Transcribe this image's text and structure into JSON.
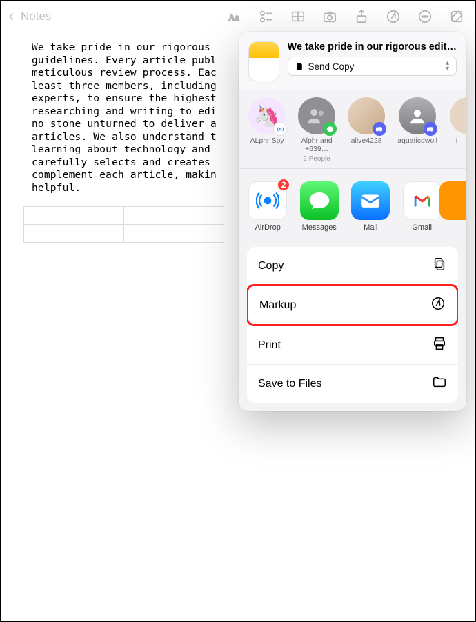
{
  "toolbar": {
    "back_label": "Notes",
    "icons": [
      "text-format",
      "checklist",
      "table",
      "camera",
      "share",
      "markup",
      "more",
      "compose"
    ]
  },
  "note": {
    "body": "We take pride in our rigorous\nguidelines. Every article publ\nmeticulous review process. Eac\nleast three members, including\nexperts, to ensure the highest\nresearching and writing to edi\nno stone unturned to deliver a\narticles. We also understand t\nlearning about technology and\ncarefully selects and creates\ncomplement each article, makin\nhelpful."
  },
  "share": {
    "title": "We take pride in our rigorous edit…",
    "send_copy_label": "Send Copy",
    "contacts": [
      {
        "name": "ALphr Spy",
        "badge": "airdrop",
        "avatarType": "emoji",
        "emoji": "🦄"
      },
      {
        "name": "Alphr and +639…",
        "sub": "2 People",
        "badge": "messages",
        "avatarType": "silhouette-pair"
      },
      {
        "name": "alive4228",
        "badge": "discord",
        "avatarType": "photo"
      },
      {
        "name": "aquaticdwoll",
        "badge": "discord",
        "avatarType": "silhouette"
      },
      {
        "name": "i",
        "avatarType": "edge"
      }
    ],
    "apps": [
      {
        "name": "AirDrop",
        "icon": "airdrop",
        "badge": "2"
      },
      {
        "name": "Messages",
        "icon": "messages"
      },
      {
        "name": "Mail",
        "icon": "mail"
      },
      {
        "name": "Gmail",
        "icon": "gmail"
      }
    ],
    "actions": [
      {
        "label": "Copy",
        "icon": "copy"
      },
      {
        "label": "Markup",
        "icon": "markup",
        "highlighted": true
      },
      {
        "label": "Print",
        "icon": "print"
      },
      {
        "label": "Save to Files",
        "icon": "folder"
      }
    ]
  }
}
